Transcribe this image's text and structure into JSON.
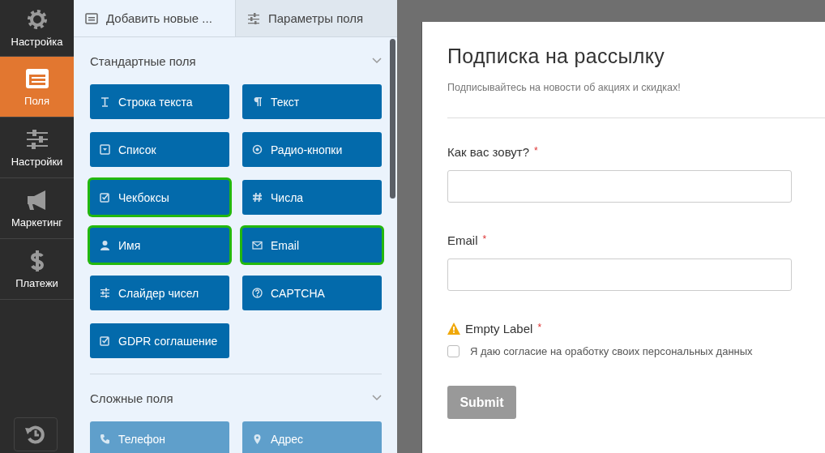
{
  "sidebar": {
    "items": [
      {
        "label": "Настройка",
        "selected": false
      },
      {
        "label": "Поля",
        "selected": true
      },
      {
        "label": "Настройки",
        "selected": false
      },
      {
        "label": "Маркетинг",
        "selected": false
      },
      {
        "label": "Платежи",
        "selected": false
      }
    ]
  },
  "tabs": [
    {
      "label": "Добавить новые ...",
      "selected": true
    },
    {
      "label": "Параметры поля",
      "selected": false
    }
  ],
  "sections": [
    {
      "title": "Стандартные поля",
      "expanded": true,
      "buttons": [
        {
          "label": "Строка текста",
          "highlighted": false,
          "disabled": false
        },
        {
          "label": "Текст",
          "highlighted": false,
          "disabled": false
        },
        {
          "label": "Список",
          "highlighted": false,
          "disabled": false
        },
        {
          "label": "Радио-кнопки",
          "highlighted": false,
          "disabled": false
        },
        {
          "label": "Чекбоксы",
          "highlighted": true,
          "disabled": false
        },
        {
          "label": "Числа",
          "highlighted": false,
          "disabled": false
        },
        {
          "label": "Имя",
          "highlighted": true,
          "disabled": false
        },
        {
          "label": "Email",
          "highlighted": true,
          "disabled": false
        },
        {
          "label": "Слайдер чисел",
          "highlighted": false,
          "disabled": false
        },
        {
          "label": "CAPTCHA",
          "highlighted": false,
          "disabled": false
        },
        {
          "label": "GDPR соглашение",
          "highlighted": false,
          "disabled": false
        }
      ]
    },
    {
      "title": "Сложные поля",
      "expanded": true,
      "buttons": [
        {
          "label": "Телефон",
          "highlighted": false,
          "disabled": true
        },
        {
          "label": "Адрес",
          "highlighted": false,
          "disabled": true
        }
      ]
    }
  ],
  "form": {
    "title": "Подписка на рассылку",
    "description": "Подписывайтесь на новости об акциях и скидках!",
    "fields": [
      {
        "kind": "text",
        "label": "Как вас зовут?",
        "required_mark": "*",
        "warning": false
      },
      {
        "kind": "text",
        "label": "Email",
        "required_mark": "*",
        "warning": false
      },
      {
        "kind": "checkbox",
        "label": "Empty Label",
        "required_mark": "*",
        "warning": true,
        "option": "Я даю согласие на оработку своих персональных данных",
        "checked": false
      }
    ],
    "submit": "Submit"
  }
}
